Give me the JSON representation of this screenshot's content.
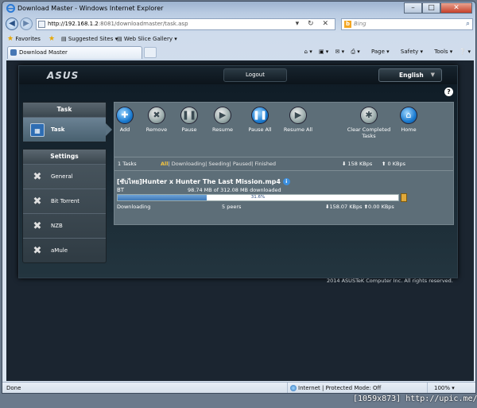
{
  "browser": {
    "title": "Download Master - Windows Internet Explorer",
    "address_host": "http://192.168.1.2",
    "address_path": ":8081/downloadmaster/task.asp",
    "search_placeholder": "Bing",
    "favorites_label": "Favorites",
    "suggested_sites": "Suggested Sites",
    "web_slice_gallery": "Web Slice Gallery",
    "tab_title": "Download Master",
    "page_menu": "Page",
    "safety_menu": "Safety",
    "tools_menu": "Tools",
    "status_done": "Done",
    "zone_text": "Internet | Protected Mode: Off",
    "zoom": "100%"
  },
  "header": {
    "logo": "ASUS",
    "logout": "Logout",
    "language": "English"
  },
  "sidebar": {
    "task_header": "Task",
    "task_item": "Task",
    "settings_header": "Settings",
    "settings_items": [
      "General",
      "Bit Torrent",
      "NZB",
      "aMule"
    ]
  },
  "toolbar": {
    "add": "Add",
    "remove": "Remove",
    "pause": "Pause",
    "resume": "Resume",
    "pause_all": "Pause All",
    "resume_all": "Resume All",
    "clear_completed": "Clear Completed Tasks",
    "home": "Home"
  },
  "status": {
    "tasks": "1 Tasks",
    "filter_all": "All",
    "filter_rest": "| Downloading| Seeding| Paused| Finished",
    "down_speed": "158 KBps",
    "up_speed": "0 KBps"
  },
  "download": {
    "name": "[ซับไทย]Hunter x Hunter The Last Mission.mp4",
    "type": "BT",
    "size_text": "98.74 MB of 312.08 MB downloaded",
    "progress_text": "31.6%",
    "progress": 0.316,
    "state": "Downloading",
    "peers": "5 peers",
    "down": "158.07 KBps",
    "up": "0.00 KBps"
  },
  "footer": {
    "copyright": "2014 ASUSTeK Computer Inc. All rights reserved."
  },
  "watermark": "[1059x873] http://upic.me/"
}
